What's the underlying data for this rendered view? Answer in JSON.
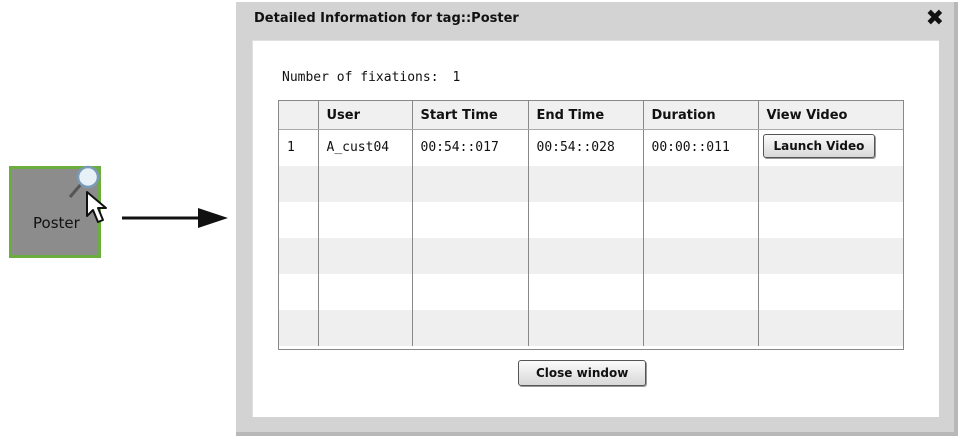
{
  "tag_node": {
    "label": "Poster"
  },
  "dialog": {
    "title": "Detailed Information for tag::Poster",
    "close_icon": "close-icon",
    "fixations_label": "Number of fixations:",
    "fixations_value": "1",
    "columns": [
      "",
      "User",
      "Start Time",
      "End Time",
      "Duration",
      "View Video"
    ],
    "rows": [
      {
        "index": "1",
        "user": "A_cust04",
        "start": "00:54::017",
        "end": "00:54::028",
        "duration": "00:00::011",
        "action": "Launch Video"
      }
    ],
    "close_button": "Close window"
  },
  "colors": {
    "tag_fill": "#8c8c8c",
    "tag_border": "#6cae3e",
    "dialog_frame": "#d3d3d3"
  }
}
